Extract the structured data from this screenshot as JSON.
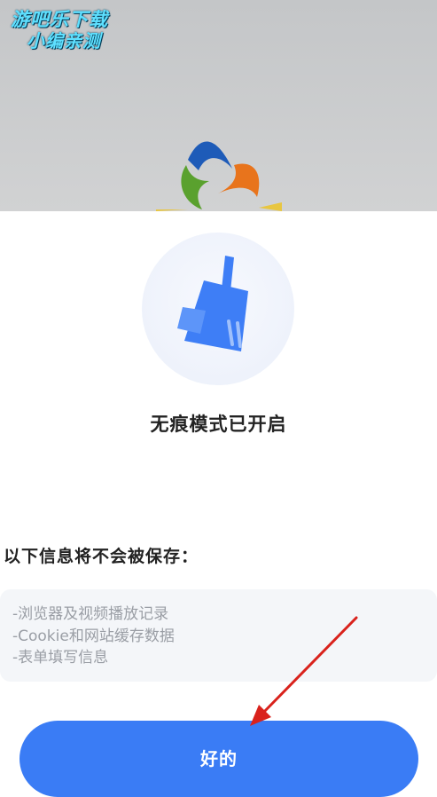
{
  "watermark": {
    "line1": "游吧乐下载",
    "line2": "小编亲测"
  },
  "dialog": {
    "icon": "broom-icon",
    "title": "无痕模式已开启",
    "info_heading": "以下信息将不会被保存：",
    "info_items": [
      "-浏览器及视频播放记录",
      "-Cookie和网站缓存数据",
      "-表单填写信息"
    ],
    "ok_label": "好的"
  },
  "colors": {
    "accent": "#3a7cf5",
    "annotation_arrow": "#d9221c"
  }
}
